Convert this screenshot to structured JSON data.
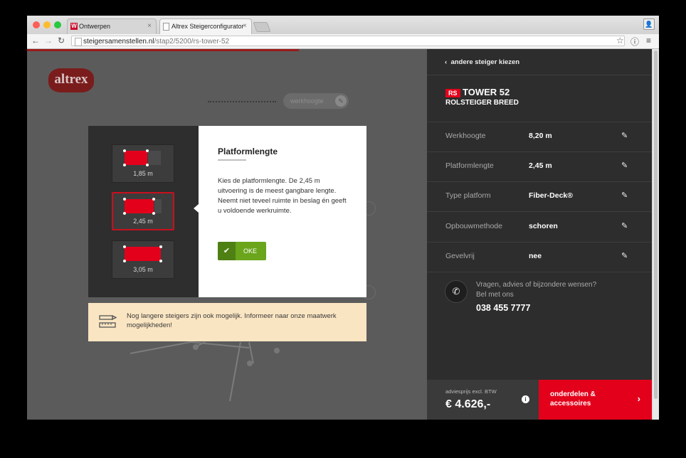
{
  "browser": {
    "tabs": [
      {
        "title": "Ontwerpen"
      },
      {
        "title": "Altrex Steigerconfigurator"
      }
    ],
    "url_domain": "steigersamenstellen.nl",
    "url_path": "/stap2/5200/rs-tower-52"
  },
  "canvas": {
    "logo": "altrex",
    "werkhoogte_label": "werkhoogte"
  },
  "modal": {
    "options": [
      {
        "label": "1,85 m",
        "selected": false
      },
      {
        "label": "2,45 m",
        "selected": true
      },
      {
        "label": "3,05 m",
        "selected": false
      }
    ],
    "title": "Platformlengte",
    "body": "Kies de platformlengte. De 2,45 m uitvoering is de meest gangbare lengte. Neemt niet teveel ruimte in beslag én geeft u voldoende werkruimte.",
    "ok_label": "OKE"
  },
  "notice": {
    "text": "Nog langere steigers zijn ook mogelijk. Informeer naar onze maatwerk mogelijkheden!"
  },
  "sidebar": {
    "back_label": "andere steiger kiezen",
    "badge": "RS",
    "product_name": "TOWER 52",
    "product_sub": "ROLSTEIGER BREED",
    "specs": [
      {
        "key": "Werkhoogte",
        "value": "8,20 m"
      },
      {
        "key": "Platformlengte",
        "value": "2,45 m"
      },
      {
        "key": "Type platform",
        "value": "Fiber-Deck®"
      },
      {
        "key": "Opbouwmethode",
        "value": "schoren"
      },
      {
        "key": "Gevelvrij",
        "value": "nee"
      }
    ],
    "contact_text": "Vragen, advies of bijzondere wensen? Bel met ons",
    "phone": "038 455 7777",
    "price_label": "adviesprijs excl. BTW",
    "price": "€ 4.626,-",
    "cta_line1": "onderdelen &",
    "cta_line2": "accessoires"
  }
}
